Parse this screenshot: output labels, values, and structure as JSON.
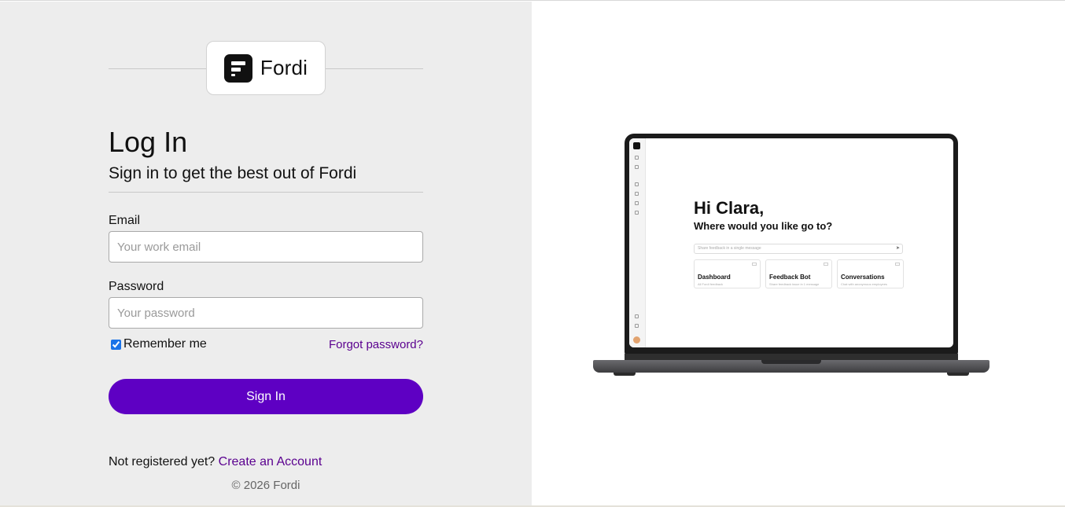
{
  "brand": {
    "name": "Fordi"
  },
  "login": {
    "title": "Log In",
    "subtitle": "Sign in to get the best out of Fordi",
    "email_label": "Email",
    "email_placeholder": "Your work email",
    "password_label": "Password",
    "password_placeholder": "Your password",
    "remember_label": "Remember me",
    "remember_checked": true,
    "forgot_label": "Forgot password?",
    "signin_label": "Sign In",
    "register_prompt": "Not registered yet?",
    "register_link": "Create an Account",
    "copyright": "© 2026 Fordi"
  },
  "preview": {
    "greeting": "Hi Clara,",
    "question": "Where would you like go to?",
    "search_placeholder": "Share feedback in a single message",
    "cards": [
      {
        "title": "Dashboard",
        "subtitle": "All Fordi feedback"
      },
      {
        "title": "Feedback Bot",
        "subtitle": "Share feedback issue in 1 message"
      },
      {
        "title": "Conversations",
        "subtitle": "Chat with anonymous employees"
      }
    ]
  },
  "colors": {
    "left_background": "#ededed",
    "accent_purple": "#5e00c3",
    "link_purple": "#5a008f"
  }
}
